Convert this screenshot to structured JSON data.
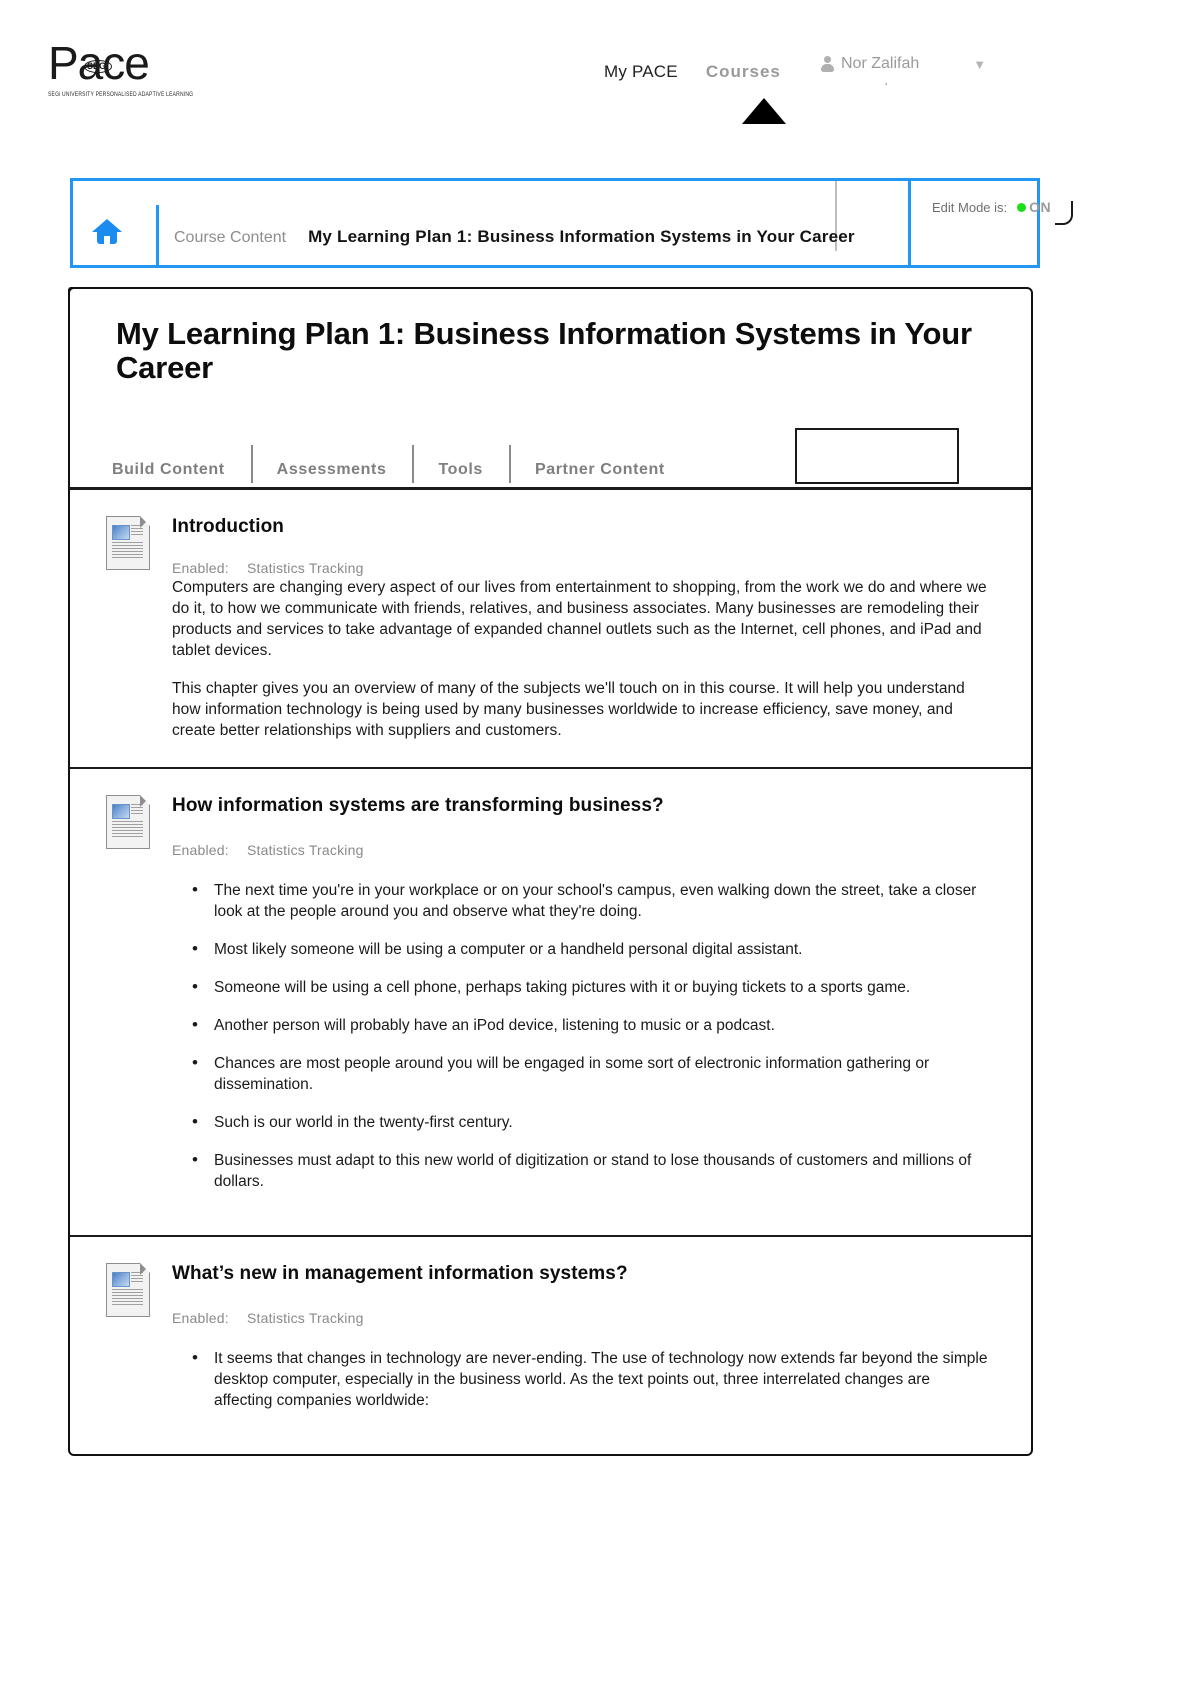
{
  "header": {
    "logo": {
      "word": "Pace",
      "badge": "SEGi",
      "subtitle": "SEGi UNIVERSITY PERSONALISED ADAPTIVE LEARNING"
    },
    "nav": [
      {
        "label": "My PACE",
        "active": true
      },
      {
        "label": "Courses",
        "active": false
      }
    ],
    "user": {
      "name": "Nor Zalifah",
      "icon": "user-avatar-icon",
      "caret": "▼"
    }
  },
  "breadcrumb": {
    "home_icon": "home-icon",
    "items": [
      {
        "label": "Course Content",
        "current": false
      },
      {
        "label": "My Learning Plan 1: Business Information Systems in Your Career",
        "current": true
      }
    ],
    "edit_mode": {
      "label": "Edit Mode is:",
      "state": "ON",
      "indicator_color": "#17e017"
    }
  },
  "page": {
    "title": "My Learning Plan 1: Business Information Systems in Your Career"
  },
  "action_bar": {
    "items": [
      {
        "label": "Build Content"
      },
      {
        "label": "Assessments"
      },
      {
        "label": "Tools"
      },
      {
        "label": "Partner Content"
      }
    ],
    "extra_button_label": ""
  },
  "content_items": [
    {
      "icon": "document-item-icon",
      "title": "Introduction",
      "meta_key": "Enabled:",
      "meta_value": "Statistics Tracking",
      "paragraphs": [
        "Computers are changing every aspect of our lives from entertainment to shopping, from the work we do and where we do it, to how we communicate with friends, relatives, and business associates. Many businesses are remodeling their products and services to take advantage of expanded channel outlets such as the Internet, cell phones, and iPad and tablet devices.",
        "This chapter gives you an overview of many of the subjects we'll touch on in this course. It will help you understand how information technology is being used by many businesses worldwide to increase efficiency, save money, and create better relationships with suppliers and customers."
      ],
      "bullets": []
    },
    {
      "icon": "document-item-icon",
      "title": "How information systems are transforming business?",
      "meta_key": "Enabled:",
      "meta_value": "Statistics Tracking",
      "paragraphs": [],
      "bullets": [
        "The next time you're in your workplace or on your school's campus, even walking down the street, take a closer look at the people around you and observe what they're doing.",
        "Most likely someone will be using a computer or a handheld personal digital assistant.",
        "Someone will be using a cell phone, perhaps taking pictures with it or buying tickets to a sports game.",
        "Another person will probably have an iPod device, listening to music or a podcast.",
        "Chances are most people around you will be engaged in some sort of electronic information gathering or dissemination.",
        "Such is our world in the twenty-first century.",
        "Businesses must adapt to this new world of digitization or stand to lose thousands of customers and millions of dollars."
      ]
    },
    {
      "icon": "document-item-icon",
      "title": "What’s new in management information systems?",
      "meta_key": "Enabled:",
      "meta_value": "Statistics Tracking",
      "paragraphs": [],
      "bullets": [
        "It seems that changes in technology are never-ending. The use of technology now extends far beyond the simple desktop computer, especially in the business world. As the text points out, three interrelated changes are affecting companies worldwide:"
      ]
    }
  ]
}
